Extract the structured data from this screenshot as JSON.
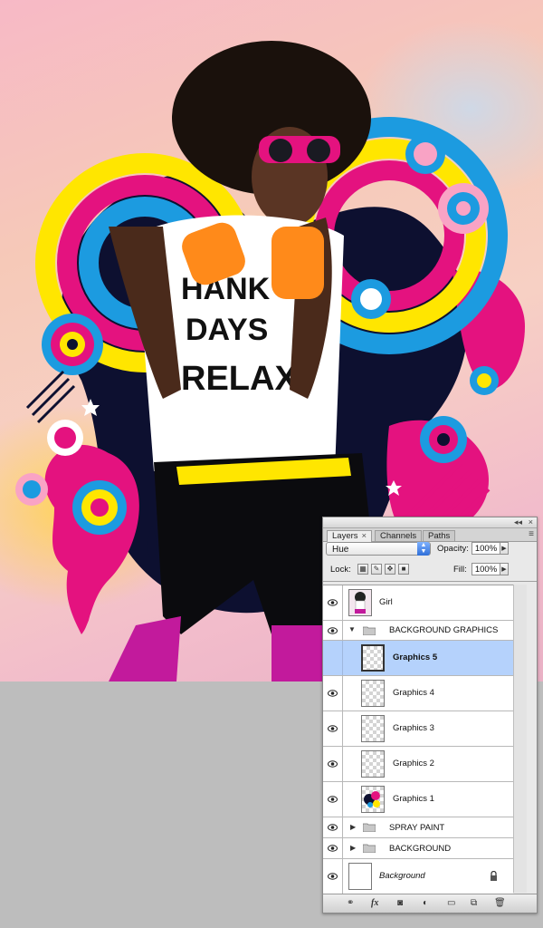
{
  "panel": {
    "tabs": [
      {
        "label": "Layers",
        "close": "×",
        "active": true
      },
      {
        "label": "Channels",
        "active": false
      },
      {
        "label": "Paths",
        "active": false
      }
    ],
    "titlebar_controls": {
      "collapse": "◂◂",
      "close": "×"
    },
    "menu_icon": "panel-menu-icon",
    "blend_mode": "Hue",
    "opacity_label": "Opacity:",
    "opacity_value": "100%",
    "lock_label": "Lock:",
    "fill_label": "Fill:",
    "fill_value": "100%",
    "lock_icons": [
      "lock-transparent-icon",
      "lock-paint-icon",
      "lock-move-icon",
      "lock-all-icon"
    ]
  },
  "layers": [
    {
      "name": "Girl",
      "type": "layer",
      "visible": true,
      "thumb": "photo"
    },
    {
      "name": "BACKGROUND GRAPHICS",
      "type": "group",
      "expanded": true,
      "visible": true
    },
    {
      "name": "Graphics 5",
      "type": "layer",
      "visible": false,
      "selected": true,
      "thumb": "empty"
    },
    {
      "name": "Graphics 4",
      "type": "layer",
      "visible": true,
      "thumb": "empty"
    },
    {
      "name": "Graphics 3",
      "type": "layer",
      "visible": true,
      "thumb": "empty"
    },
    {
      "name": "Graphics 2",
      "type": "layer",
      "visible": true,
      "thumb": "empty"
    },
    {
      "name": "Graphics 1",
      "type": "layer",
      "visible": true,
      "thumb": "art"
    },
    {
      "name": "SPRAY PAINT",
      "type": "group",
      "expanded": false,
      "visible": true
    },
    {
      "name": "BACKGROUND",
      "type": "group",
      "expanded": false,
      "visible": true
    },
    {
      "name": "Background",
      "type": "layer",
      "visible": true,
      "thumb": "white",
      "locked": true
    }
  ],
  "bottom_icons": [
    "link-layers-icon",
    "fx-icon",
    "layer-mask-icon",
    "adjustment-layer-icon",
    "new-group-icon",
    "new-layer-icon",
    "trash-icon"
  ],
  "bottom_labels": {
    "fx": "fx"
  },
  "colors": {
    "selection": "#b5d2fc",
    "blend_arrow": "#2f6fd8",
    "workspace": "#bdbdbd"
  }
}
